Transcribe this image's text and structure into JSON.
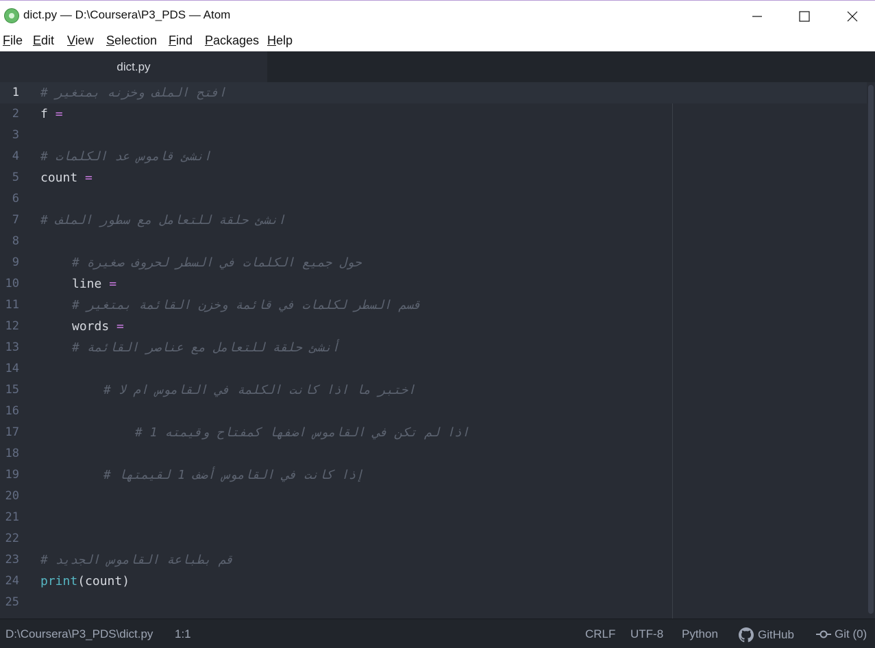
{
  "window": {
    "title": "dict.py — D:\\Coursera\\P3_PDS — Atom"
  },
  "menu": [
    "File",
    "Edit",
    "View",
    "Selection",
    "Find",
    "Packages",
    "Help"
  ],
  "tab": {
    "label": "dict.py"
  },
  "lines": [
    {
      "n": "1",
      "indent": 0,
      "tokens": [
        {
          "t": "# افتح الملف وخزنه بمتغير",
          "c": "comment"
        }
      ]
    },
    {
      "n": "2",
      "indent": 0,
      "tokens": [
        {
          "t": "f ",
          "c": "var"
        },
        {
          "t": "=",
          "c": "op"
        }
      ]
    },
    {
      "n": "3",
      "indent": 0,
      "tokens": []
    },
    {
      "n": "4",
      "indent": 0,
      "tokens": [
        {
          "t": "# انشئ قاموس عد الكلمات",
          "c": "comment"
        }
      ]
    },
    {
      "n": "5",
      "indent": 0,
      "tokens": [
        {
          "t": "count ",
          "c": "var"
        },
        {
          "t": "=",
          "c": "op"
        }
      ]
    },
    {
      "n": "6",
      "indent": 0,
      "tokens": []
    },
    {
      "n": "7",
      "indent": 0,
      "tokens": [
        {
          "t": "# انشئ حلقة للتعامل مع سطور الملف",
          "c": "comment"
        }
      ]
    },
    {
      "n": "8",
      "indent": 0,
      "tokens": []
    },
    {
      "n": "9",
      "indent": 1,
      "tokens": [
        {
          "t": "# حول جميع الكلمات في السطر لحروف صغيرة",
          "c": "comment"
        }
      ]
    },
    {
      "n": "10",
      "indent": 1,
      "tokens": [
        {
          "t": "line ",
          "c": "var"
        },
        {
          "t": "=",
          "c": "op"
        }
      ]
    },
    {
      "n": "11",
      "indent": 1,
      "tokens": [
        {
          "t": "# قسم السطر لكلمات في قائمة وخزن القائمة بمتغير",
          "c": "comment"
        }
      ]
    },
    {
      "n": "12",
      "indent": 1,
      "tokens": [
        {
          "t": "words ",
          "c": "var"
        },
        {
          "t": "=",
          "c": "op"
        }
      ]
    },
    {
      "n": "13",
      "indent": 1,
      "tokens": [
        {
          "t": "# أنشئ حلقة للتعامل مع عناصر القائمة",
          "c": "comment"
        }
      ]
    },
    {
      "n": "14",
      "indent": 0,
      "tokens": []
    },
    {
      "n": "15",
      "indent": 2,
      "tokens": [
        {
          "t": "# اختبر ما اذا كانت الكلمة في القاموس ام لا",
          "c": "comment"
        }
      ]
    },
    {
      "n": "16",
      "indent": 0,
      "tokens": []
    },
    {
      "n": "17",
      "indent": 3,
      "tokens": [
        {
          "t": "# اذا لم تكن في القاموس اضفها كمفتاح وقيمته 1",
          "c": "comment"
        }
      ]
    },
    {
      "n": "18",
      "indent": 0,
      "tokens": []
    },
    {
      "n": "19",
      "indent": 2,
      "tokens": [
        {
          "t": "# إذا كانت في القاموس أضف 1 لقيمتها",
          "c": "comment"
        }
      ]
    },
    {
      "n": "20",
      "indent": 0,
      "tokens": []
    },
    {
      "n": "21",
      "indent": 0,
      "tokens": []
    },
    {
      "n": "22",
      "indent": 0,
      "tokens": []
    },
    {
      "n": "23",
      "indent": 0,
      "tokens": [
        {
          "t": "# قم بطباعة القاموس الجديد",
          "c": "comment"
        }
      ]
    },
    {
      "n": "24",
      "indent": 0,
      "tokens": [
        {
          "t": "print",
          "c": "fn"
        },
        {
          "t": "(count)",
          "c": "var"
        }
      ]
    },
    {
      "n": "25",
      "indent": 0,
      "tokens": []
    }
  ],
  "status": {
    "path": "D:\\Coursera\\P3_PDS\\dict.py",
    "cursor": "1:1",
    "line_ending": "CRLF",
    "encoding": "UTF-8",
    "grammar": "Python",
    "github": "GitHub",
    "git": "Git (0)"
  },
  "colors": {
    "comment": "#5c6370",
    "operator": "#c678dd",
    "function": "#56b6c2",
    "text": "#d7dae0"
  }
}
